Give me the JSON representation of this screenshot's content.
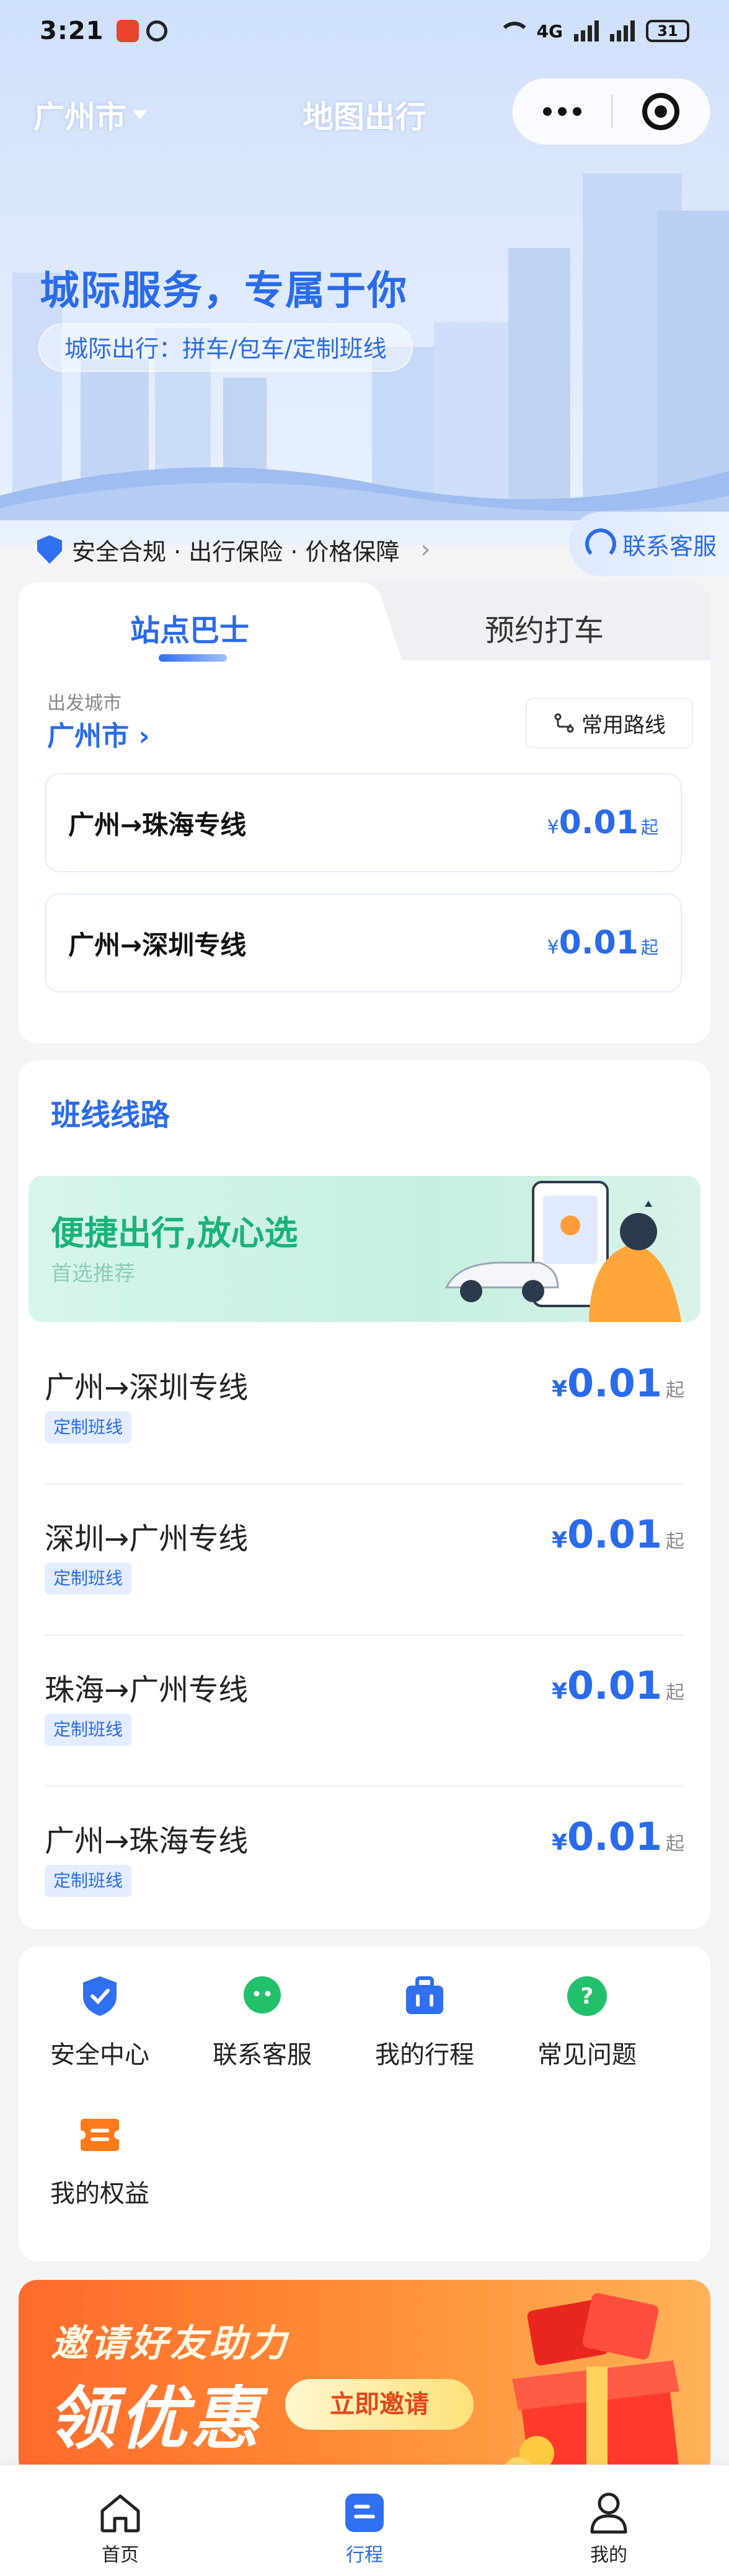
{
  "status_bar": {
    "time": "3:21",
    "battery": "31",
    "network": "4G"
  },
  "nav": {
    "city": "广州市",
    "title": "地图出行"
  },
  "hero": {
    "slogan": "城际服务，专属于你",
    "sub_slogan": "城际出行：拼车/包车/定制班线"
  },
  "safety": {
    "text": "安全合规 · 出行保险 · 价格保障",
    "service_label": "联系客服"
  },
  "booking": {
    "tabs": [
      {
        "label": "站点巴士",
        "active": true
      },
      {
        "label": "预约打车",
        "active": false
      }
    ],
    "depart_label": "出发城市",
    "depart_city": "广州市",
    "common_routes_label": "常用路线",
    "routes": [
      {
        "name": "广州→珠海专线",
        "currency": "¥",
        "price": "0.01",
        "suffix": "起"
      },
      {
        "name": "广州→深圳专线",
        "currency": "¥",
        "price": "0.01",
        "suffix": "起"
      }
    ]
  },
  "lines": {
    "title": "班线线路",
    "promo": {
      "headline": "便捷出行,放心选",
      "subline": "首选推荐"
    },
    "items": [
      {
        "name": "广州→深圳专线",
        "tag": "定制班线",
        "currency": "¥",
        "price": "0.01",
        "suffix": "起"
      },
      {
        "name": "深圳→广州专线",
        "tag": "定制班线",
        "currency": "¥",
        "price": "0.01",
        "suffix": "起"
      },
      {
        "name": "珠海→广州专线",
        "tag": "定制班线",
        "currency": "¥",
        "price": "0.01",
        "suffix": "起"
      },
      {
        "name": "广州→珠海专线",
        "tag": "定制班线",
        "currency": "¥",
        "price": "0.01",
        "suffix": "起"
      }
    ]
  },
  "quick_services": [
    {
      "label": "安全中心",
      "icon": "shield-check-icon",
      "color": "#2f6ff0"
    },
    {
      "label": "联系客服",
      "icon": "chat-bubble-icon",
      "color": "#22c06b"
    },
    {
      "label": "我的行程",
      "icon": "briefcase-icon",
      "color": "#2f6ff0"
    },
    {
      "label": "常见问题",
      "icon": "question-icon",
      "color": "#22c06b"
    },
    {
      "label": "我的权益",
      "icon": "ticket-icon",
      "color": "#ff7a1a"
    }
  ],
  "invite": {
    "line1": "邀请好友助力",
    "line2": "领优惠",
    "button": "立即邀请"
  },
  "tabbar": [
    {
      "label": "首页",
      "icon": "home-icon",
      "active": false
    },
    {
      "label": "行程",
      "icon": "trip-icon",
      "active": true
    },
    {
      "label": "我的",
      "icon": "user-icon",
      "active": false
    }
  ],
  "colors": {
    "brand_blue": "#2a6bea",
    "green": "#19b27a",
    "orange": "#ff7a1a"
  }
}
